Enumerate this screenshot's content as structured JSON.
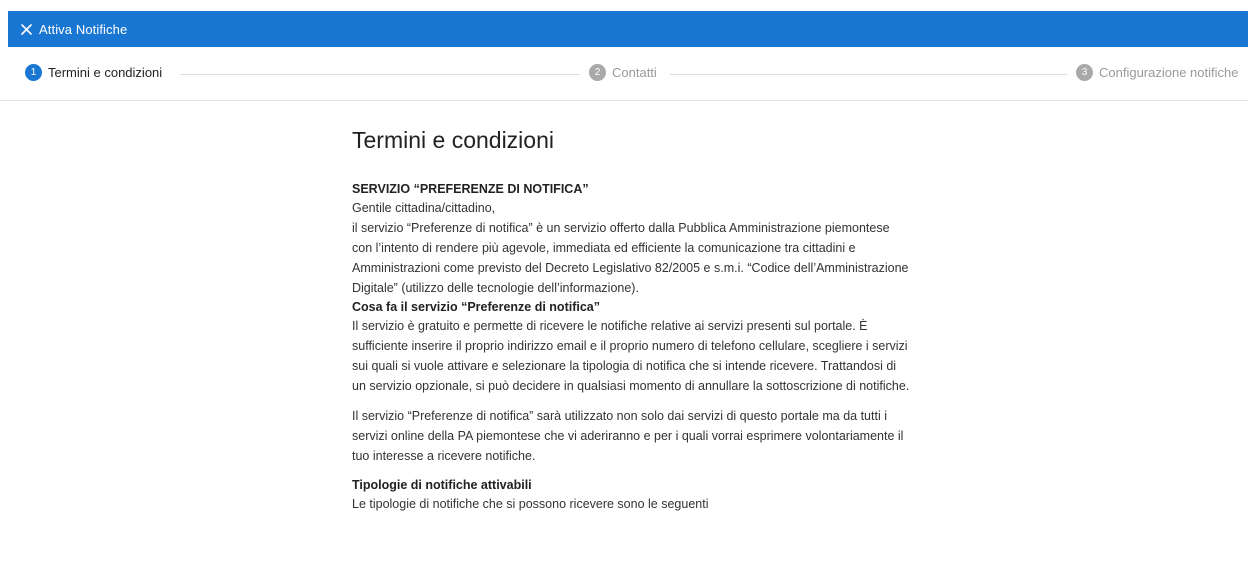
{
  "header": {
    "title": "Attiva Notifiche",
    "close_icon": "close-icon"
  },
  "stepper": {
    "steps": [
      {
        "number": "1",
        "label": "Termini e condizioni",
        "state": "active"
      },
      {
        "number": "2",
        "label": "Contatti",
        "state": "inactive"
      },
      {
        "number": "3",
        "label": "Configurazione notifiche",
        "state": "inactive"
      }
    ]
  },
  "colors": {
    "primary": "#1976d2",
    "inactive": "#a9a9a9"
  },
  "main": {
    "title": "Termini e condizioni",
    "section1_heading": "SERVIZIO “PREFERENZE DI NOTIFICA”",
    "greeting": "Gentile cittadina/cittadino,",
    "para1": "il servizio “Preferenze di notifica” è un servizio offerto dalla Pubblica Amministrazione piemontese con l’intento di rendere più agevole, immediata ed efficiente la comunicazione tra cittadini e Amministrazioni come previsto del Decreto Legislativo 82/2005 e s.m.i. “Codice dell’Amministrazione Digitale” (utilizzo delle tecnologie dell’informazione).",
    "section2_heading": "Cosa fa il servizio “Preferenze di notifica”",
    "para2": "Il servizio è gratuito e permette di ricevere le notifiche relative ai servizi presenti sul portale. È sufficiente inserire il proprio indirizzo email e il proprio numero di telefono cellulare, scegliere i servizi sui quali si vuole attivare e selezionare la tipologia di notifica che si intende ricevere. Trattandosi di un servizio opzionale, si può decidere in qualsiasi momento di annullare la sottoscrizione di notifiche.",
    "para3": "Il servizio “Preferenze di notifica” sarà utilizzato non solo dai servizi di questo portale ma da tutti i servizi online della PA piemontese che vi aderiranno e per i quali vorrai esprimere volontariamente il tuo interesse a ricevere notifiche.",
    "section3_heading": "Tipologie di notifiche attivabili",
    "para4": "Le tipologie di notifiche che si possono ricevere sono le seguenti"
  }
}
